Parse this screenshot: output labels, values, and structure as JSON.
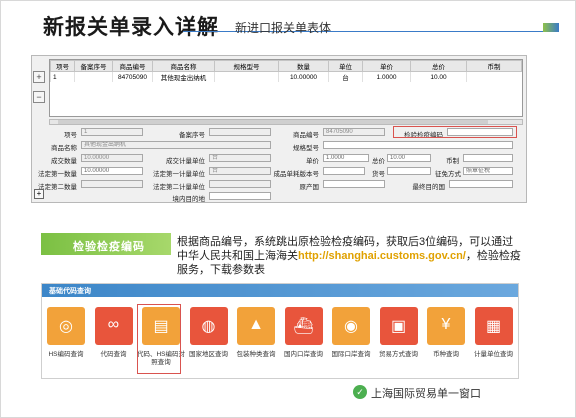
{
  "header": {
    "title": "新报关单录入详解",
    "subtitle": "新进口报关单表体"
  },
  "grid": {
    "columns": [
      "项号",
      "备案序号",
      "商品编号",
      "商品名称",
      "规格型号",
      "数量",
      "单位",
      "单价",
      "总价",
      "币制"
    ],
    "rows": [
      [
        "1",
        "",
        "84705090",
        "其他现金出纳机",
        "",
        "10.00000",
        "台",
        "1.0000",
        "10.00",
        ""
      ]
    ]
  },
  "side_buttons": [
    "+",
    "−"
  ],
  "form": {
    "fields": [
      {
        "label": "项号",
        "value": "1"
      },
      {
        "label": "备案序号",
        "value": ""
      },
      {
        "label": "商品编号",
        "value": "84705090"
      },
      {
        "label": "检验检疫编码",
        "value": ""
      },
      {
        "label": "商品名称",
        "value": "其他现金出纳机"
      },
      {
        "label": "规格型号",
        "value": ""
      },
      {
        "label": "成交数量",
        "value": "10.00000"
      },
      {
        "label": "成交计量单位",
        "value": "台"
      },
      {
        "label": "单价",
        "value": "1.0000"
      },
      {
        "label": "总价",
        "value": "10.00"
      },
      {
        "label": "币制",
        "value": ""
      },
      {
        "label": "法定第一数量",
        "value": "10.00000"
      },
      {
        "label": "法定第一计量单位",
        "value": "台"
      },
      {
        "label": "成品单耗版本号",
        "value": ""
      },
      {
        "label": "货号",
        "value": ""
      },
      {
        "label": "征免方式",
        "value": "照章征税"
      },
      {
        "label": "法定第二数量",
        "value": ""
      },
      {
        "label": "法定第二计量单位",
        "value": ""
      },
      {
        "label": "原产国",
        "value": ""
      },
      {
        "label": "最终目的国",
        "value": ""
      },
      {
        "label": "境内目的地",
        "value": ""
      }
    ],
    "add_button": "+"
  },
  "section": {
    "banner": "检验检疫编码",
    "desc_part1": "根据商品编号，系统跳出原检验检疫编码，获取后3位编码，可以通过中华人民共和国上海海关",
    "url": "http://shanghai.customs.gov.cn/",
    "desc_part2": "，检验检疫服务，下载参数表"
  },
  "query_panel": {
    "title": "基础代码查询",
    "tiles": [
      {
        "label": "HS编码查询",
        "color": "#f2a23a",
        "icon": "hs-code-icon"
      },
      {
        "label": "代码查询",
        "color": "#e8553c",
        "icon": "link-icon"
      },
      {
        "label": "代码、HS编码对照查询",
        "color": "#f2a23a",
        "icon": "id-card-icon"
      },
      {
        "label": "国家地区查询",
        "color": "#e8553c",
        "icon": "globe-icon"
      },
      {
        "label": "包装种类查询",
        "color": "#f2a23a",
        "icon": "package-icon"
      },
      {
        "label": "国内口岸查询",
        "color": "#e8553c",
        "icon": "ship-icon"
      },
      {
        "label": "国际口岸查询",
        "color": "#f2a23a",
        "icon": "world-port-icon"
      },
      {
        "label": "贸易方式查询",
        "color": "#e8553c",
        "icon": "passport-icon"
      },
      {
        "label": "币种查询",
        "color": "#f2a23a",
        "icon": "currency-icon"
      },
      {
        "label": "计量单位查询",
        "color": "#e8553c",
        "icon": "measure-icon"
      }
    ]
  },
  "footer": {
    "text": "上海国际贸易单一窗口",
    "icon": "wechat-icon"
  }
}
